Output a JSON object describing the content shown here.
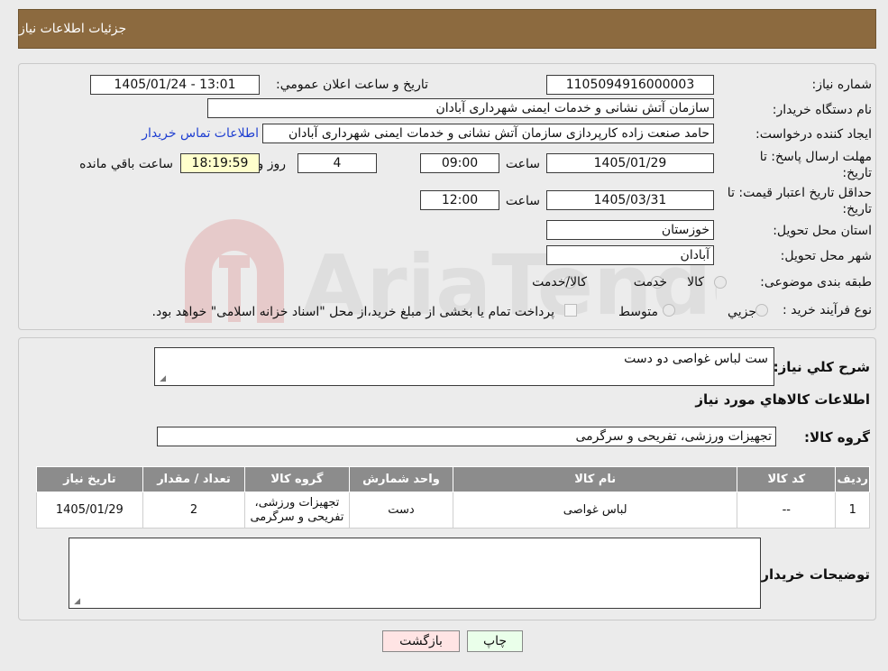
{
  "page_title": "جزئیات اطلاعات نیاز",
  "watermark_text": "AriaTender.neT",
  "fields": {
    "need_number_label": "شماره نیاز:",
    "need_number": "1105094916000003",
    "announce_label": "تاريخ و ساعت اعلان عمومي:",
    "announce_value": "1405/01/24 - 13:01",
    "buyer_org_label": "نام دستگاه خریدار:",
    "buyer_org": "سازمان آتش نشانی و خدمات ایمنی شهرداری آبادان",
    "requester_label": "ایجاد کننده درخواست:",
    "requester": "حامد صنعت زاده کارپردازی سازمان آتش نشانی و خدمات ایمنی شهرداری آبادان",
    "contact_link": "اطلاعات تماس خریدار",
    "send_deadline_label_1": "مهلت ارسال پاسخ: تا",
    "send_deadline_label_2": "تاریخ:",
    "send_deadline_date": "1405/01/29",
    "time_label": "ساعت",
    "send_deadline_time": "09:00",
    "days_value": "4",
    "days_label": "روز و",
    "remaining_time": "18:19:59",
    "remaining_label": "ساعت باقي مانده",
    "price_validity_label_1": "حداقل تاریخ اعتبار قیمت: تا",
    "price_validity_label_2": "تاریخ:",
    "price_validity_date": "1405/03/31",
    "price_validity_time": "12:00",
    "province_label": "استان محل تحویل:",
    "province": "خوزستان",
    "city_label": "شهر محل تحویل:",
    "city": "آبادان",
    "category_label": "طبقه بندی موضوعی:",
    "category_options": [
      "کالا",
      "خدمت",
      "کالا/خدمت"
    ],
    "process_label": "نوع فرآیند خرید :",
    "process_options": [
      "جزیي",
      "متوسط"
    ],
    "process_note": "پرداخت تمام یا بخشی از مبلغ خرید،از محل \"اسناد خزانه اسلامی\" خواهد بود."
  },
  "details": {
    "summary_label": "شرح کلي نياز:",
    "summary_value": "ست لباس غواصی دو دست",
    "goods_info_title": "اطلاعات کالاهاي مورد نياز",
    "goods_group_label": "گروه کالا:",
    "goods_group_value": "تجهیزات ورزشی، تفریحی و سرگرمی",
    "table": {
      "headers": [
        "رديف",
        "کد کالا",
        "نام کالا",
        "واحد شمارش",
        "گروه کالا",
        "تعداد / مقدار",
        "تاریخ نیاز"
      ],
      "rows": [
        {
          "row": "1",
          "code": "--",
          "name": "لباس غواصی",
          "unit": "دست",
          "group": "تجهیزات ورزشی، تفریحی و سرگرمی",
          "qty": "2",
          "date": "1405/01/29"
        }
      ]
    },
    "buyer_notes_label": "توضیحات خریدار:",
    "buyer_notes_value": ""
  },
  "buttons": {
    "print": "چاپ",
    "back": "بازگشت"
  }
}
